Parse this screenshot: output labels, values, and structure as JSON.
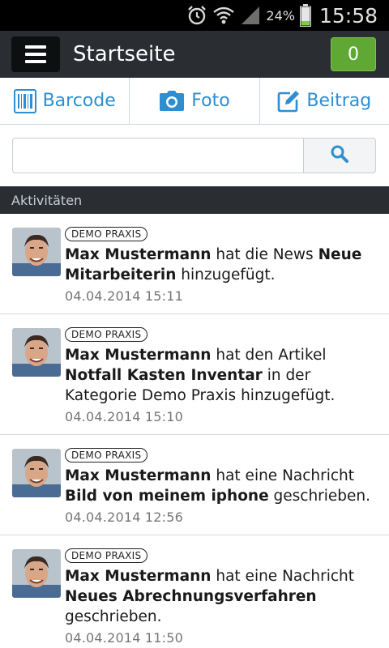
{
  "status_bar": {
    "battery_percent": "24%",
    "time": "15:58",
    "icons": [
      "alarm-icon",
      "wifi-icon",
      "signal-icon",
      "battery-icon"
    ]
  },
  "action_bar": {
    "title": "Startseite",
    "badge_count": "0"
  },
  "tabs": [
    {
      "label": "Barcode",
      "icon": "barcode-icon"
    },
    {
      "label": "Foto",
      "icon": "camera-icon"
    },
    {
      "label": "Beitrag",
      "icon": "edit-icon"
    }
  ],
  "search": {
    "value": "",
    "placeholder": ""
  },
  "section": {
    "title": "Aktivitäten"
  },
  "colors": {
    "accent": "#2d8ed1",
    "badge_green": "#5ea833",
    "bar_dark": "#2a2e33"
  },
  "activities": [
    {
      "tag": "DEMO PRAXIS",
      "user": "Max Mustermann",
      "text1": " hat die News ",
      "subject": "Neue Mitarbeiterin",
      "text2": " hinzugefügt.",
      "timestamp": "04.04.2014 15:11"
    },
    {
      "tag": "DEMO PRAXIS",
      "user": "Max Mustermann",
      "text1": " hat den Artikel ",
      "subject": "Notfall Kasten Inventar",
      "text2": " in der Kategorie Demo Praxis hinzugefügt.",
      "timestamp": "04.04.2014 15:10"
    },
    {
      "tag": "DEMO PRAXIS",
      "user": "Max Mustermann",
      "text1": " hat eine Nachricht ",
      "subject": "Bild von meinem iphone",
      "text2": " geschrieben.",
      "timestamp": "04.04.2014 12:56"
    },
    {
      "tag": "DEMO PRAXIS",
      "user": "Max Mustermann",
      "text1": " hat eine Nachricht ",
      "subject": "Neues Abrechnungsverfahren",
      "text2": " geschrieben.",
      "timestamp": "04.04.2014 11:50"
    }
  ]
}
